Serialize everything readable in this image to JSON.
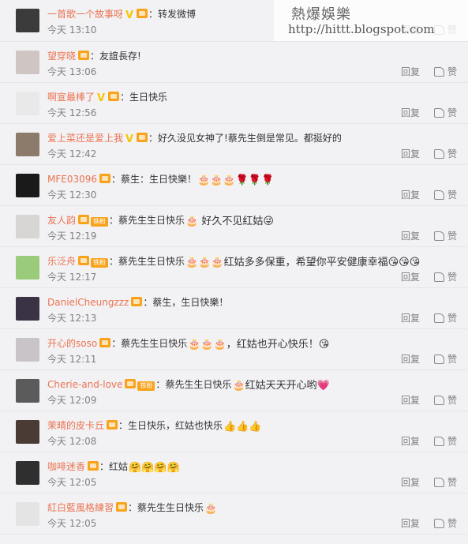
{
  "comments": [
    {
      "user": "一首歌一个故事呀",
      "verified": true,
      "fan": false,
      "text": "转发微博",
      "emoji": "",
      "time": "今天 13:10",
      "reply": "回复",
      "like": "赞",
      "avatar_color": "#3b3b3b"
    },
    {
      "user": "望穿晓",
      "verified": false,
      "fan": false,
      "text": "友誼長存!",
      "emoji": "",
      "time": "今天 13:06",
      "reply": "回复",
      "like": "赞",
      "avatar_color": "#cfc6c4"
    },
    {
      "user": "啊宣最棒了",
      "verified": true,
      "fan": false,
      "text": "生日快乐",
      "emoji": "",
      "time": "今天 12:56",
      "reply": "回复",
      "like": "赞",
      "avatar_color": "#e9e9e9"
    },
    {
      "user": "爱上菜还是爱上我",
      "verified": true,
      "fan": false,
      "text": "好久没见女神了!蔡先生倒是常见。都挺好的",
      "emoji": "",
      "time": "今天 12:42",
      "reply": "回复",
      "like": "赞",
      "avatar_color": "#8c7a6a"
    },
    {
      "user": "MFE03096",
      "verified": false,
      "fan": false,
      "text": "蔡生：生日快樂！",
      "emoji": "🎂🎂🎂🌹🌹🌹",
      "time": "今天 12:30",
      "reply": "回复",
      "like": "赞",
      "avatar_color": "#1a1a1a"
    },
    {
      "user": "友人韵",
      "verified": false,
      "fan": true,
      "fan_label": "铁粉",
      "text": "蔡先生生日快乐",
      "emoji": "🎂 好久不见红姑😜",
      "time": "今天 12:19",
      "reply": "回复",
      "like": "赞",
      "avatar_color": "#d8d6d4"
    },
    {
      "user": "乐泛舟",
      "verified": false,
      "fan": true,
      "fan_label": "铁粉",
      "text": "蔡先生生日快乐",
      "emoji": "🎂🎂🎂红姑多多保重，希望你平安健康幸福😘😘😘",
      "time": "今天 12:17",
      "reply": "回复",
      "like": "赞",
      "avatar_color": "#9acb7a"
    },
    {
      "user": "DanielCheungzzz",
      "verified": false,
      "fan": false,
      "text": "蔡生，生日快樂！",
      "emoji": "",
      "time": "今天 12:13",
      "reply": "回复",
      "like": "赞",
      "avatar_color": "#3a3346"
    },
    {
      "user": "开心的soso",
      "verified": false,
      "fan": false,
      "text": "蔡先生生日快乐",
      "emoji": "🎂🎂🎂，红姑也开心快乐！😘",
      "time": "今天 12:11",
      "reply": "回复",
      "like": "赞",
      "avatar_color": "#c9c4c8"
    },
    {
      "user": "Cherie-and-love",
      "verified": false,
      "fan": true,
      "fan_label": "铁粉",
      "text": "蔡先生生日快乐",
      "emoji": "🎂红姑天天开心哟💗",
      "time": "今天 12:09",
      "reply": "回复",
      "like": "赞",
      "avatar_color": "#5b5b5b"
    },
    {
      "user": "茉晴的皮卡丘",
      "verified": false,
      "fan": false,
      "text": "生日快乐，红姑也快乐",
      "emoji": "👍👍👍",
      "time": "今天 12:08",
      "reply": "回复",
      "like": "赞",
      "avatar_color": "#4a3b34"
    },
    {
      "user": "咖啡迷香",
      "verified": false,
      "fan": false,
      "text": "红姑",
      "emoji": "🤗🤗🤗🤗",
      "time": "今天 12:05",
      "reply": "回复",
      "like": "赞",
      "avatar_color": "#2f2f2f"
    },
    {
      "user": "紅白藍風格練習",
      "verified": false,
      "fan": false,
      "text": "蔡先生生日快乐",
      "emoji": "🎂",
      "time": "今天 12:05",
      "reply": "回复",
      "like": "赞",
      "avatar_color": "#e4e4e4"
    }
  ],
  "watermark": {
    "line1": "熱爆娛樂",
    "line2": "http://hittt.blogspot.com"
  }
}
